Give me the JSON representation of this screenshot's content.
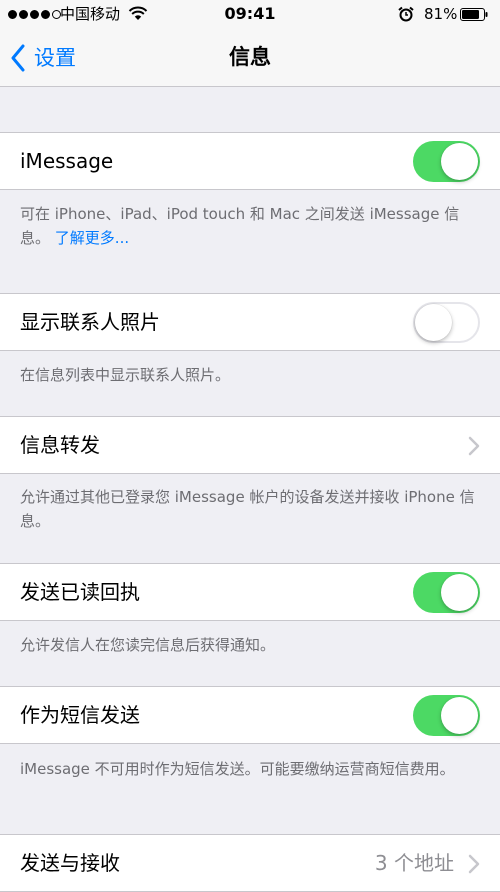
{
  "status_bar": {
    "carrier": "中国移动",
    "time": "09:41",
    "battery": "81%",
    "battery_level": 0.81,
    "signal_strength": 4,
    "icons": [
      "signal-dots-icon",
      "wifi-icon",
      "alarm-clock-icon",
      "battery-icon"
    ]
  },
  "nav": {
    "back_label": "设置",
    "title": "信息"
  },
  "rows": {
    "imessage": {
      "label": "iMessage",
      "toggle": "on"
    },
    "contact_photos": {
      "label": "显示联系人照片",
      "toggle": "off"
    },
    "forwarding": {
      "label": "信息转发"
    },
    "read_receipts": {
      "label": "发送已读回执",
      "toggle": "on"
    },
    "send_as_sms": {
      "label": "作为短信发送",
      "toggle": "on"
    },
    "send_receive": {
      "label": "发送与接收",
      "detail": "3 个地址"
    }
  },
  "footers": {
    "imessage": "可在 iPhone、iPad、iPod touch 和 Mac 之间发送 iMessage 信息。",
    "imessage_link": "了解更多...",
    "contact_photos": "在信息列表中显示联系人照片。",
    "forwarding": "允许通过其他已登录您 iMessage 帐户的设备发送并接收 iPhone 信息。",
    "read_receipts": "允许发信人在您读完信息后获得通知。",
    "send_as_sms": "iMessage 不可用时作为短信发送。可能要缴纳运营商短信费用。"
  },
  "colors": {
    "accent": "#007aff",
    "toggle_on": "#4cd964",
    "background": "#efeff4",
    "secondary_text": "#6d6d72"
  }
}
